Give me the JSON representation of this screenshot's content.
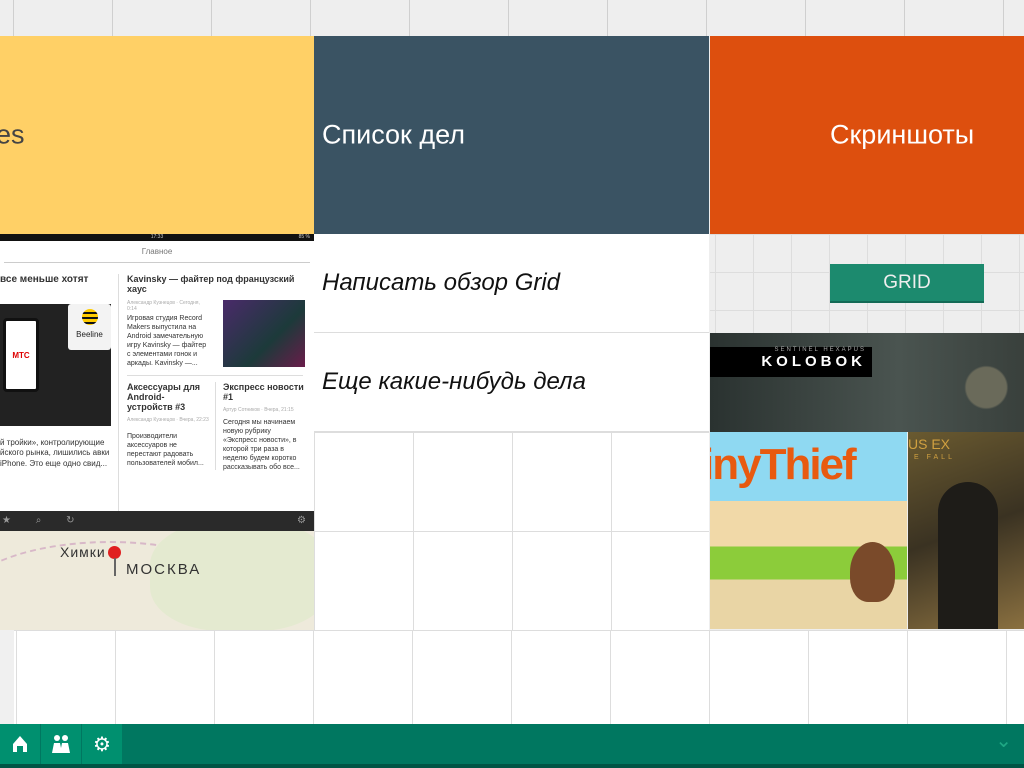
{
  "tiles": {
    "yellow": {
      "title": "es",
      "color": "#ffd066"
    },
    "todo": {
      "title": "Список дел",
      "color": "#3a5363"
    },
    "screens": {
      "title": "Скриншоты",
      "color": "#dd4f0e"
    }
  },
  "todo_items": [
    "Написать обзор Grid",
    "Еще какие-нибудь дела"
  ],
  "grid_button": "GRID",
  "news_app": {
    "time": "17:33",
    "battery": "85 %",
    "header": "Главное",
    "a1_title": "все меньше хотят",
    "a1_text": "й тройки», контролирующие йского рынка, лишились авки iPhone. Это еще одно свид...",
    "a2_title": "Kavinsky — файтер под французский хаус",
    "a2_meta": "Александр Кузнецов · Сегодня, 0:14",
    "a2_text": "Игровая студия Record Makers выпустила на Android замечательную игру Kavinsky — файтер с элементами гонок и аркады. Kavinsky —...",
    "a3_title": "Аксессуары для Android-устройств #3",
    "a3_meta": "Александр Кузнецов · Вчера, 22:23",
    "a3_text": "Производители аксессуаров не перестают радовать пользователей мобил...",
    "a4_title": "Экспресс новости #1",
    "a4_meta": "Артур Сотников · Вчера, 21:15",
    "a4_text": "Сегодня мы начинаем новую рубрику «Экспресс новости», в которой три раза в неделю будем коротко рассказывать обо все...",
    "brand1": "МТС",
    "brand2": "Beeline"
  },
  "map": {
    "city1": "Химки",
    "city2": "Москва"
  },
  "games": {
    "kolobok_sub": "SENTINEL HEXAPUS",
    "kolobok": "KOLOBOK",
    "thief": "inyThief",
    "deus": "US EX",
    "deus_sub": "E FALL"
  },
  "bottom_bar": {
    "icons": [
      "home-icon",
      "users-icon",
      "gear-icon"
    ],
    "chevron": "⌄"
  }
}
